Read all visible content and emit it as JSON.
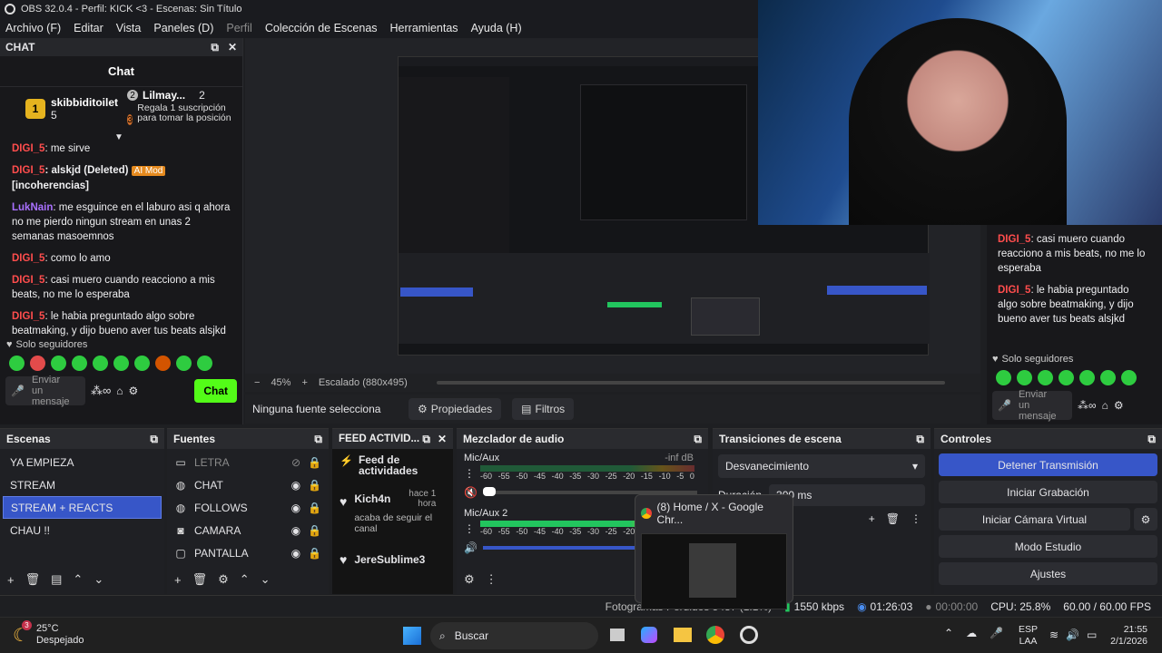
{
  "window": {
    "title": "OBS 32.0.4 - Perfil: KICK <3 - Escenas: Sin Título"
  },
  "menu": [
    "Archivo (F)",
    "Editar",
    "Vista",
    "Paneles (D)",
    "Perfil",
    "Colección de Escenas",
    "Herramientas",
    "Ayuda (H)"
  ],
  "chat": {
    "dock_title": "CHAT",
    "title": "Chat",
    "leader1": {
      "rank": "1",
      "name": "skibbiditoilet",
      "count": "5"
    },
    "leader2": {
      "rank": "2",
      "name": "Lilmay...",
      "count": "2"
    },
    "leader3": {
      "rank": "3",
      "text": "Regala 1 suscripción para tomar la posición"
    },
    "messages": [
      {
        "user": "DIGI_5",
        "text": ": me sirve",
        "color": "red"
      },
      {
        "user": "DIGI_5",
        "text": ": alskjd (Deleted)",
        "badge": "AI Mod",
        "extra": "[incoherencias]",
        "color": "red"
      },
      {
        "user": "LukNain",
        "text": ": me esguince en el laburo asi q ahora no me pierdo ningun stream en unas 2 semanas masoemnos",
        "color": "purple"
      },
      {
        "user": "DIGI_5",
        "text": ": como lo amo",
        "color": "red"
      },
      {
        "user": "DIGI_5",
        "text": ": casi muero cuando reacciono a mis beats, no me lo esperaba",
        "color": "red"
      },
      {
        "user": "DIGI_5",
        "text": ": le habia preguntado algo sobre beatmaking, y dijo bueno aver tus beats alsjkd",
        "color": "red"
      }
    ],
    "followers_only": "Solo seguidores",
    "input_placeholder": "Enviar un mensaje",
    "send_label": "Chat"
  },
  "right_chat": {
    "messages": [
      {
        "user": "DIGI_5",
        "text": ": casi muero cuando reacciono a mis beats, no me lo esperaba"
      },
      {
        "user": "DIGI_5",
        "text": ": le habia preguntado algo sobre beatmaking, y dijo bueno aver tus beats alsjkd"
      }
    ],
    "followers_only": "Solo seguidores",
    "input_placeholder": "Enviar un mensaje"
  },
  "canvas": {
    "zoom": "45%",
    "scaling": "Escalado (880x495)"
  },
  "selection": {
    "none": "Ninguna fuente selecciona",
    "properties": "Propiedades",
    "filters": "Filtros"
  },
  "scenes": {
    "title": "Escenas",
    "items": [
      "YA EMPIEZA",
      "STREAM",
      "STREAM + REACTS",
      "CHAU !!"
    ],
    "selected": 2
  },
  "sources": {
    "title": "Fuentes",
    "items": [
      {
        "name": "LETRA",
        "icon": "text-icon",
        "hidden": true
      },
      {
        "name": "CHAT",
        "icon": "globe-icon",
        "hidden": false
      },
      {
        "name": "FOLLOWS",
        "icon": "globe-icon",
        "hidden": false
      },
      {
        "name": "CAMARA",
        "icon": "camera-icon",
        "hidden": false
      },
      {
        "name": "PANTALLA",
        "icon": "monitor-icon",
        "hidden": false
      }
    ]
  },
  "feed": {
    "title": "FEED ACTIVID...",
    "header": "Feed de actividades",
    "items": [
      {
        "user": "Kich4n",
        "time": "hace 1 hora",
        "text": "acaba de seguir el canal"
      },
      {
        "user": "JereSublime3",
        "time": "",
        "text": ""
      }
    ]
  },
  "mixer": {
    "title": "Mezclador de audio",
    "channels": [
      {
        "name": "Mic/Aux",
        "level": "-inf dB"
      },
      {
        "name": "Mic/Aux 2",
        "level": ""
      }
    ],
    "scale": [
      "-60",
      "-55",
      "-50",
      "-45",
      "-40",
      "-35",
      "-30",
      "-25",
      "-20",
      "-15",
      "-10",
      "-5",
      "0"
    ]
  },
  "transitions": {
    "title": "Transiciones de escena",
    "type": "Desvanecimiento",
    "duration_label": "Duración",
    "duration_value": "300 ms"
  },
  "controls": {
    "title": "Controles",
    "buttons": [
      "Detener Transmisión",
      "Iniciar Grabación",
      "Iniciar Cámara Virtual",
      "Modo Estudio",
      "Ajustes"
    ]
  },
  "popup": {
    "title": "(8) Home / X - Google Chr..."
  },
  "status": {
    "dropped": "Fotogramas Perdidos 5487 (1.1%)",
    "bitrate": "1550 kbps",
    "live": "01:26:03",
    "rec": "00:00:00",
    "cpu": "CPU: 25.8%",
    "fps": "60.00 / 60.00 FPS"
  },
  "taskbar": {
    "temp": "25°C",
    "weather": "Despejado",
    "search": "Buscar",
    "lang1": "ESP",
    "lang2": "LAA",
    "time": "21:55",
    "date": "2/1/2026",
    "badge": "3"
  },
  "colors": {
    "accent": "#3756c8",
    "chat_green": "#53fc18",
    "red_user": "#ff4d4d",
    "purple_user": "#a970ff"
  }
}
